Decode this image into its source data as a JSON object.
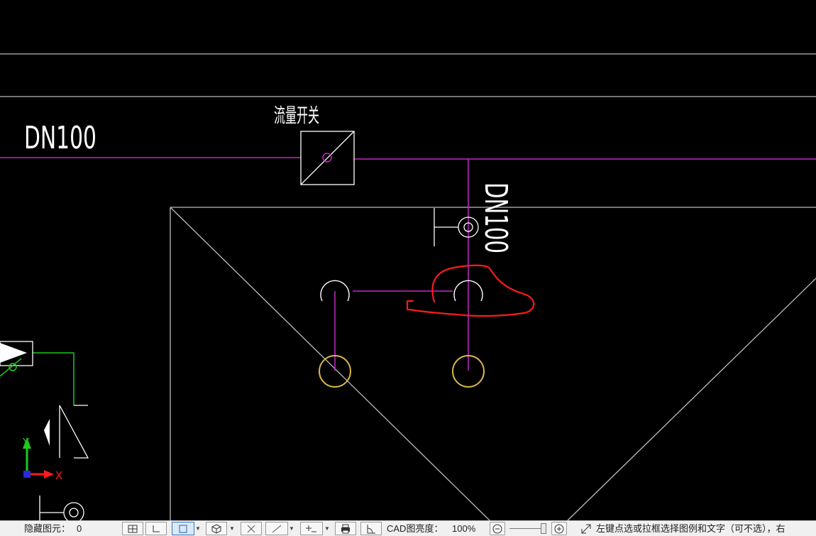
{
  "drawing": {
    "label_flow_switch": "流量开关",
    "label_pipe_horizontal": "DN100",
    "label_pipe_vertical": "DN100",
    "ucs_y_label": "Y",
    "ucs_x_label": "X"
  },
  "statusbar": {
    "hidden_elements_label": "隐藏图元：",
    "hidden_elements_count": "0",
    "cad_brightness_label": "CAD图亮度：",
    "cad_brightness_value": "100%",
    "zoom_minus_icon": "zoom-out-icon",
    "zoom_plus_icon": "zoom-in-icon",
    "hint": "左键点选或拉框选择图例和文字（可不选），右"
  },
  "colors": {
    "background": "#000000",
    "pipe_magenta": "#c428c4",
    "pipe_green": "#1ec81e",
    "line_white": "#ffffff",
    "line_gray": "#bdbdbd",
    "sprinkler_gold": "#d9b44a",
    "annotation_red": "#ff1a1a",
    "statusbar_bg": "#f0f0f0"
  }
}
